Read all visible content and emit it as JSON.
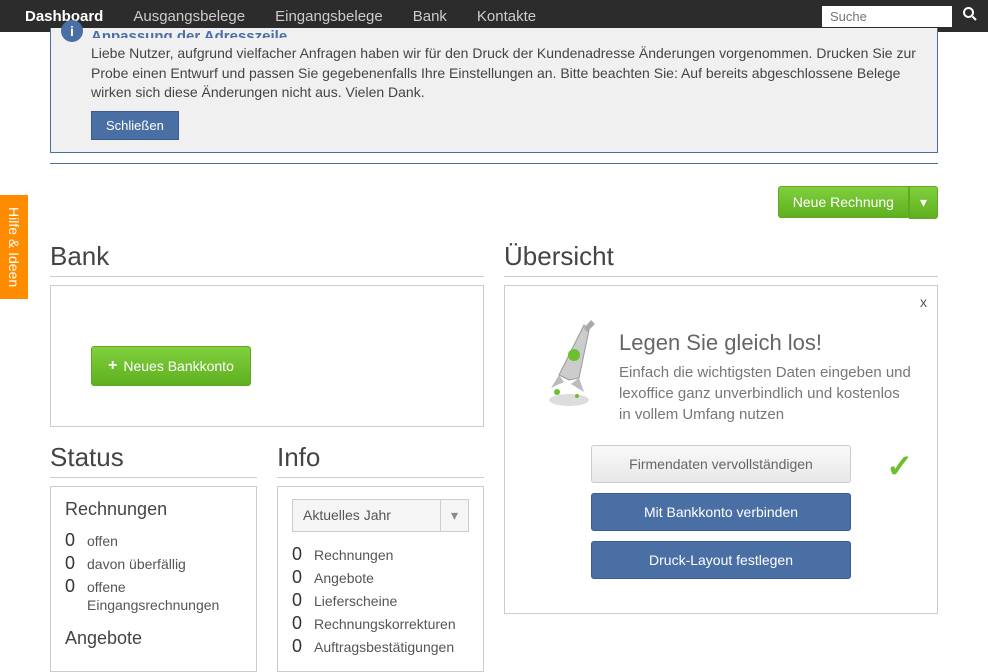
{
  "nav": {
    "items": [
      "Dashboard",
      "Ausgangsbelege",
      "Eingangsbelege",
      "Bank",
      "Kontakte"
    ],
    "active_index": 0,
    "search_placeholder": "Suche"
  },
  "help_tab": "Hilfe & Ideen",
  "banner": {
    "title": "Anpassung der Adresszeile",
    "body": "Liebe Nutzer, aufgrund vielfacher Anfragen haben wir für den Druck der Kundenadresse Änderungen vorgenommen. Drucken Sie zur Probe einen Entwurf und passen Sie gegebenenfalls Ihre Einstellungen an. Bitte beachten Sie: Auf bereits abgeschlossene Belege wirken sich diese Änderungen nicht aus. Vielen Dank.",
    "close": "Schließen"
  },
  "action": {
    "new_invoice": "Neue Rechnung"
  },
  "bank": {
    "heading": "Bank",
    "new_account": "Neues Bankkonto"
  },
  "status": {
    "heading": "Status",
    "invoices_header": "Rechnungen",
    "lines": [
      {
        "n": "0",
        "label": "offen"
      },
      {
        "n": "0",
        "label": "davon überfällig"
      },
      {
        "n": "0",
        "label": "offene Eingangsrechnungen"
      }
    ],
    "offers_header": "Angebote"
  },
  "info": {
    "heading": "Info",
    "year_select": "Aktuelles Jahr",
    "lines": [
      {
        "n": "0",
        "label": "Rechnungen"
      },
      {
        "n": "0",
        "label": "Angebote"
      },
      {
        "n": "0",
        "label": "Lieferscheine"
      },
      {
        "n": "0",
        "label": "Rechnungskorrekturen"
      },
      {
        "n": "0",
        "label": "Auftragsbestätigungen"
      }
    ]
  },
  "overview": {
    "heading": "Übersicht",
    "close": "x",
    "title": "Legen Sie gleich los!",
    "body": "Einfach die wichtigsten Daten eingeben und lexoffice ganz unverbindlich und kostenlos in vollem Umfang nutzen",
    "btn_company": "Firmendaten vervollständigen",
    "btn_bank": "Mit Bankkonto verbinden",
    "btn_print": "Druck-Layout festlegen"
  }
}
